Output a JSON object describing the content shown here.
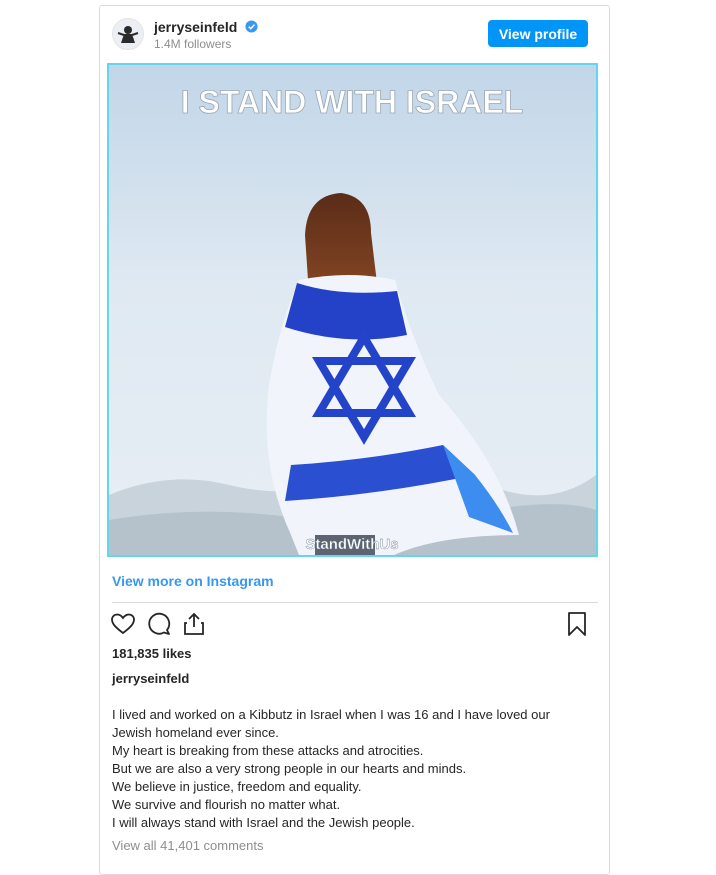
{
  "header": {
    "username": "jerryseinfeld",
    "followers": "1.4M followers",
    "view_profile_label": "View profile"
  },
  "photo": {
    "headline": "I STAND WITH ISRAEL",
    "watermark": "StandWithUs",
    "colors": {
      "sky": "#dce8f2",
      "flag_blue": "#1f3fc4",
      "flag_white": "#f4f6fb",
      "hair": "#7a3d20"
    }
  },
  "view_more_label": "View more on Instagram",
  "actions": {
    "icons": [
      "heart-icon",
      "comment-icon",
      "share-icon",
      "bookmark-icon"
    ]
  },
  "likes": "181,835 likes",
  "caption": {
    "username": "jerryseinfeld",
    "lines": [
      "I lived and worked on a Kibbutz in Israel when I was 16 and I have loved our",
      "Jewish homeland ever since.",
      "My heart is breaking from these attacks and atrocities.",
      "But we are also a very strong people in our hearts and minds.",
      "We believe in justice, freedom and equality.",
      "We survive and flourish no matter what.",
      "I will always stand with Israel and the Jewish people."
    ]
  },
  "comments_link": "View all 41,401 comments",
  "accent_color": "#0095f6",
  "link_color": "#3897f0"
}
